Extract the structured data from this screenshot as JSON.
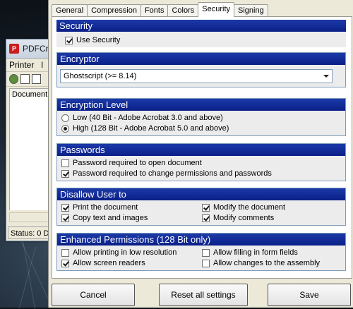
{
  "background_window": {
    "title": "PDFCre",
    "menu": [
      "Printer",
      "l"
    ],
    "list_header": "Document",
    "status": "Status: 0 D"
  },
  "tabs": [
    {
      "label": "General",
      "active": false
    },
    {
      "label": "Compression",
      "active": false
    },
    {
      "label": "Fonts",
      "active": false
    },
    {
      "label": "Colors",
      "active": false
    },
    {
      "label": "Security",
      "active": true
    },
    {
      "label": "Signing",
      "active": false
    }
  ],
  "security": {
    "header": "Security",
    "use_security": {
      "label": "Use Security",
      "checked": true
    }
  },
  "encryptor": {
    "header": "Encryptor",
    "selected": "Ghostscript (>= 8.14)"
  },
  "encryption_level": {
    "header": "Encryption Level",
    "options": [
      {
        "label": "Low (40 Bit - Adobe Acrobat 3.0 and above)",
        "checked": false
      },
      {
        "label": "High (128 Bit - Adobe Acrobat 5.0 and above)",
        "checked": true
      }
    ]
  },
  "passwords": {
    "header": "Passwords",
    "items": [
      {
        "label": "Password required to open document",
        "checked": false
      },
      {
        "label": "Password required to change permissions and passwords",
        "checked": true
      }
    ]
  },
  "disallow": {
    "header": "Disallow User to",
    "items": [
      {
        "label": "Print the document",
        "checked": true
      },
      {
        "label": "Modify the document",
        "checked": true
      },
      {
        "label": "Copy text and images",
        "checked": true
      },
      {
        "label": "Modify comments",
        "checked": true
      }
    ]
  },
  "enhanced": {
    "header": "Enhanced Permissions (128 Bit only)",
    "items": [
      {
        "label": "Allow printing in low resolution",
        "checked": false
      },
      {
        "label": "Allow filling in form fields",
        "checked": false
      },
      {
        "label": "Allow screen readers",
        "checked": true
      },
      {
        "label": "Allow changes to the assembly",
        "checked": false
      }
    ]
  },
  "buttons": {
    "cancel": "Cancel",
    "reset": "Reset all settings",
    "save": "Save"
  },
  "colors": {
    "section_header": "#0a1f87"
  }
}
